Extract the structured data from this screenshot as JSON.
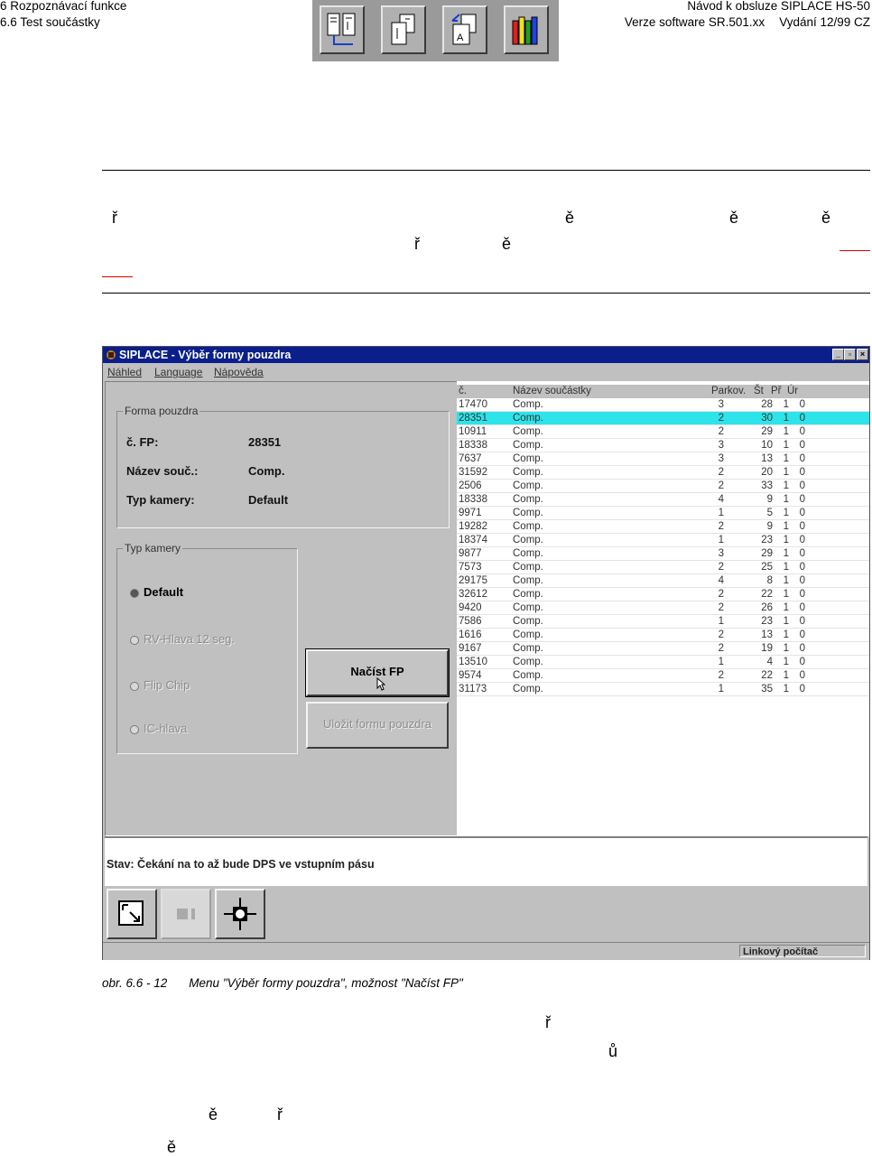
{
  "header": {
    "chapter": "6 Rozpoznávací funkce",
    "section": "6.6 Test součástky",
    "manual": "Návod k obsluze SIPLACE HS-50",
    "version": "Verze software SR.501.xx",
    "edition": "Vydání 12/99 CZ"
  },
  "body_fragments": {
    "f1": "ř",
    "f2": "ě",
    "f3": "ě",
    "f4": "ě",
    "f5": "ř",
    "f6": "ě",
    "f7": "ř",
    "f8": "ů",
    "f9": "ě",
    "f10": "ř",
    "f11": "ě"
  },
  "window": {
    "title": "SIPLACE - Výběr formy pouzdra",
    "menu": [
      "Náhled",
      "Language",
      "Nápověda"
    ],
    "form": {
      "group_label": "Forma pouzdra",
      "fields": [
        {
          "label": "č. FP:",
          "value": "28351"
        },
        {
          "label": "Název souč.:",
          "value": "Comp."
        },
        {
          "label": "Typ kamery:",
          "value": "Default"
        }
      ]
    },
    "camera": {
      "group_label": "Typ kamery",
      "options": [
        {
          "label": "Default",
          "selected": true,
          "enabled": true
        },
        {
          "label": "RV-Hlava 12 seg.",
          "selected": false,
          "enabled": false
        },
        {
          "label": "Flip Chip",
          "selected": false,
          "enabled": false
        },
        {
          "label": "IC-hlava",
          "selected": false,
          "enabled": false
        }
      ]
    },
    "buttons": {
      "load": "Načíst FP",
      "save": "Uložit formu pouzdra"
    },
    "list": {
      "headers": [
        "č.",
        "Název součástky",
        "Parkov.",
        "Št",
        "Př",
        "Úr"
      ],
      "selected_index": 1,
      "rows": [
        [
          "17470",
          "Comp.",
          "3",
          "28",
          "1",
          "0"
        ],
        [
          "28351",
          "Comp.",
          "2",
          "30",
          "1",
          "0"
        ],
        [
          "10911",
          "Comp.",
          "2",
          "29",
          "1",
          "0"
        ],
        [
          "18338",
          "Comp.",
          "3",
          "10",
          "1",
          "0"
        ],
        [
          "7637",
          "Comp.",
          "3",
          "13",
          "1",
          "0"
        ],
        [
          "31592",
          "Comp.",
          "2",
          "20",
          "1",
          "0"
        ],
        [
          "2506",
          "Comp.",
          "2",
          "33",
          "1",
          "0"
        ],
        [
          "18338",
          "Comp.",
          "4",
          "9",
          "1",
          "0"
        ],
        [
          "9971",
          "Comp.",
          "1",
          "5",
          "1",
          "0"
        ],
        [
          "19282",
          "Comp.",
          "2",
          "9",
          "1",
          "0"
        ],
        [
          "18374",
          "Comp.",
          "1",
          "23",
          "1",
          "0"
        ],
        [
          "9877",
          "Comp.",
          "3",
          "29",
          "1",
          "0"
        ],
        [
          "7573",
          "Comp.",
          "2",
          "25",
          "1",
          "0"
        ],
        [
          "29175",
          "Comp.",
          "4",
          "8",
          "1",
          "0"
        ],
        [
          "32612",
          "Comp.",
          "2",
          "22",
          "1",
          "0"
        ],
        [
          "9420",
          "Comp.",
          "2",
          "26",
          "1",
          "0"
        ],
        [
          "7586",
          "Comp.",
          "1",
          "23",
          "1",
          "0"
        ],
        [
          "1616",
          "Comp.",
          "2",
          "13",
          "1",
          "0"
        ],
        [
          "9167",
          "Comp.",
          "2",
          "19",
          "1",
          "0"
        ],
        [
          "13510",
          "Comp.",
          "1",
          "4",
          "1",
          "0"
        ],
        [
          "9574",
          "Comp.",
          "2",
          "22",
          "1",
          "0"
        ],
        [
          "31173",
          "Comp.",
          "1",
          "35",
          "1",
          "0"
        ]
      ]
    },
    "status": "Stav:  Čekání na to až bude DPS ve vstupním pásu",
    "statusbar_panel": "Linkový počítač"
  },
  "caption": {
    "number": "obr. 6.6 - 12",
    "text": "Menu \"Výběr formy pouzdra\", možnost \"Načíst FP\""
  }
}
